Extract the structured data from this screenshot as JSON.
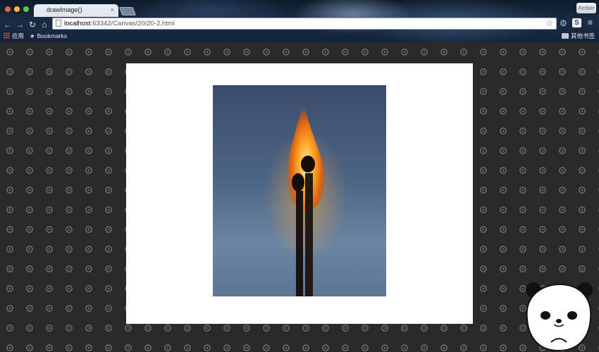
{
  "browser": {
    "tab_title": "drawImage()",
    "tab_close": "×",
    "user_button": "Amber",
    "url_host": "localhost",
    "url_path": ":63342/Canvas/20/20-2.html",
    "bookmarks": {
      "apps_label": "应用",
      "bookmarks_label": "Bookmarks",
      "other_label": "其他书签"
    },
    "icons": [
      "back-icon",
      "forward-icon",
      "reload-icon",
      "home-icon",
      "page-icon",
      "star-icon",
      "gear-icon",
      "s-extension-icon",
      "menu-icon",
      "apps-grid-icon",
      "folder-icon"
    ]
  },
  "page": {
    "background": "#2a2a2a",
    "canvas_color": "#ffffff",
    "image_subject": "two matchsticks with a flame",
    "mascot": "panda-sticker"
  }
}
